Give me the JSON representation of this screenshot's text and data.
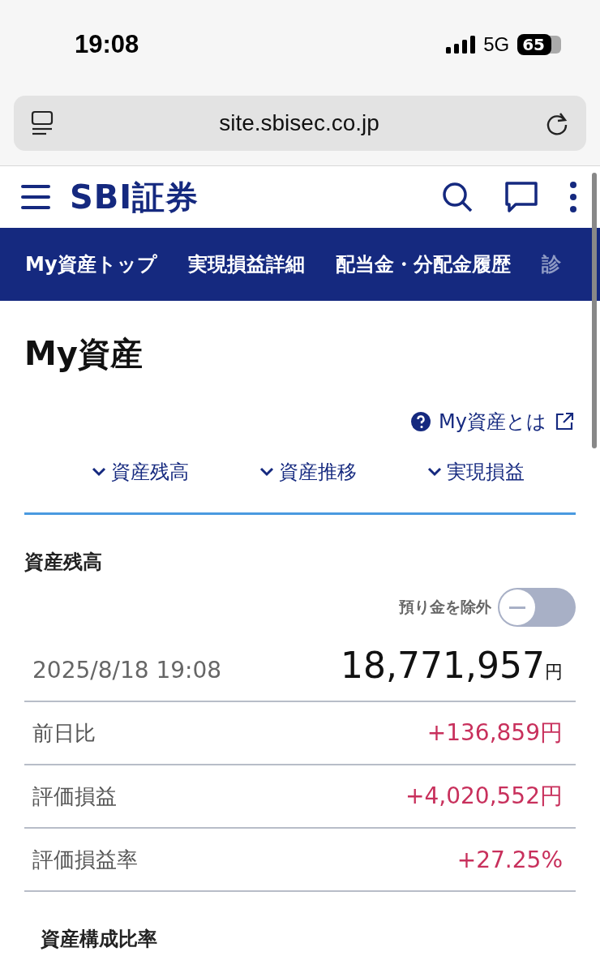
{
  "status_bar": {
    "time": "19:08",
    "network": "5G",
    "battery": "65"
  },
  "browser": {
    "url": "site.sbisec.co.jp"
  },
  "header": {
    "logo": "SBI証券"
  },
  "nav_tabs": [
    {
      "label": "My資産トップ",
      "faded": false
    },
    {
      "label": "実現損益詳細",
      "faded": false
    },
    {
      "label": "配当金・分配金履歴",
      "faded": false
    },
    {
      "label": "診",
      "faded": true
    }
  ],
  "page_title": "My資産",
  "help_link": "My資産とは",
  "anchors": [
    "資産残高",
    "資産推移",
    "実現損益"
  ],
  "section": {
    "heading": "資産残高",
    "toggle": {
      "label": "預り金を除外",
      "on": false
    },
    "date": "2025/8/18 19:08",
    "total": "18,771,957",
    "unit": "円",
    "rows": [
      {
        "label": "前日比",
        "value": "+136,859円"
      },
      {
        "label": "評価損益",
        "value": "+4,020,552円"
      },
      {
        "label": "評価損益率",
        "value": "+27.25%"
      }
    ]
  },
  "next_heading": "資産構成比率"
}
